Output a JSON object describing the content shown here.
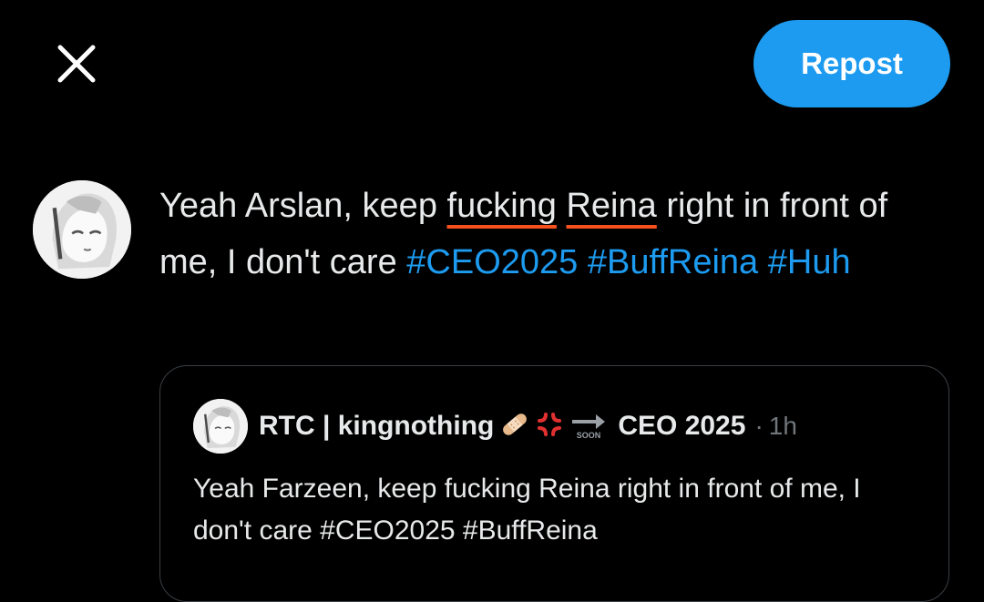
{
  "header": {
    "close_icon": "close-icon",
    "repost_label": "Repost"
  },
  "compose": {
    "avatar_icon": "anime-avatar",
    "text": {
      "t1": "Yeah Arslan, keep ",
      "w1": "fucking",
      "s1": " ",
      "w2": "Reina",
      "t2": " right in front of me, I don't care ",
      "tag1": "#CEO2025",
      "sp1": " ",
      "tag2": "#BuffReina",
      "sp2": " ",
      "tag3": "#Huh"
    },
    "spellcheck_color": "#f4511e"
  },
  "quote": {
    "avatar_icon": "anime-avatar",
    "name": "RTC | kingnothing",
    "emojis": [
      "bandage-emoji",
      "anger-emoji",
      "soon-arrow-emoji"
    ],
    "soon_label": "SOON",
    "name_suffix": "CEO 2025",
    "dot": "·",
    "time": "1h",
    "text": "Yeah Farzeen, keep fucking Reina right in front of me, I don't care #CEO2025 #BuffReina"
  },
  "colors": {
    "background": "#000000",
    "accent": "#1d9bf0",
    "text": "#e7e9ea",
    "muted": "#71767b",
    "border": "#3a3f44"
  }
}
